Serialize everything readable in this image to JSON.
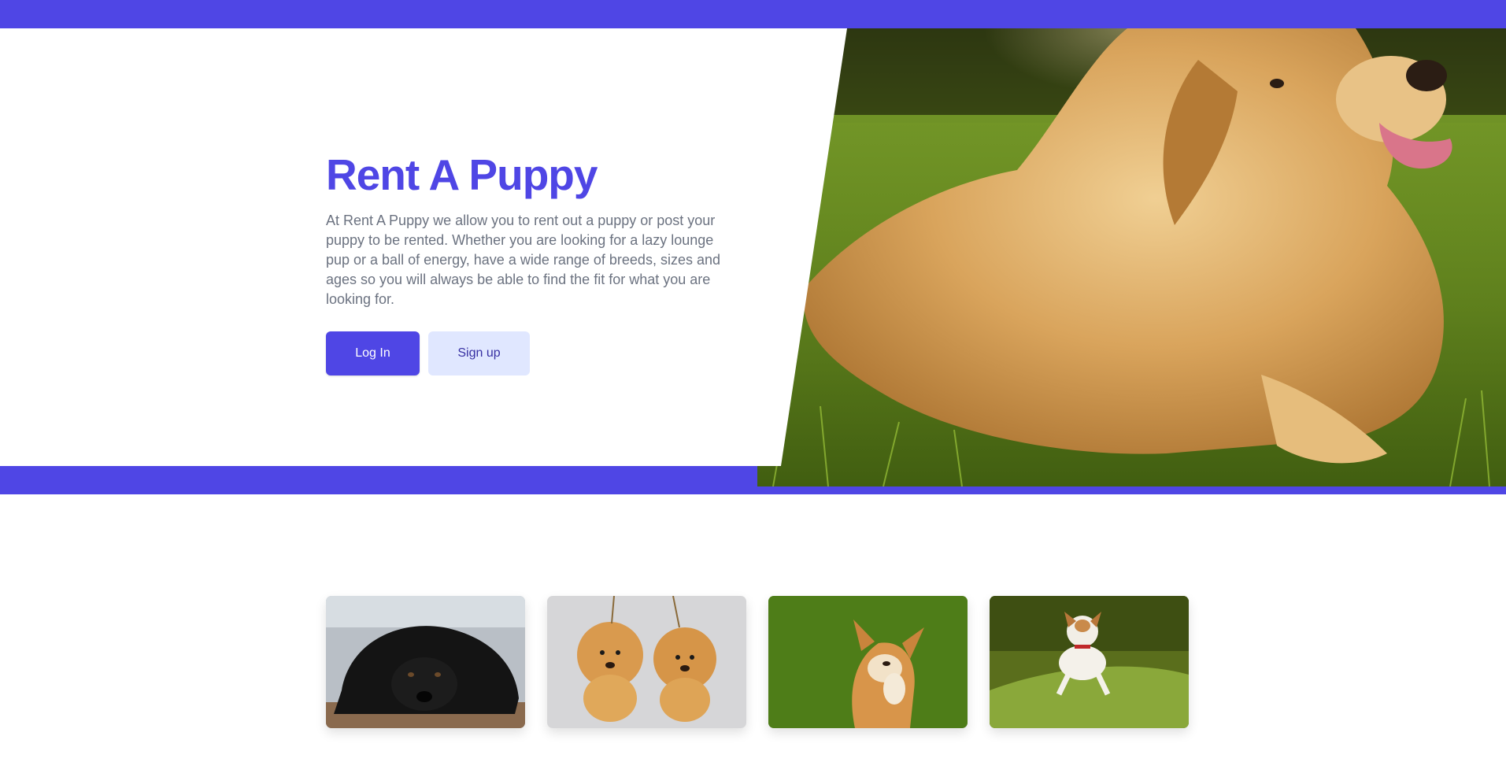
{
  "hero": {
    "title": "Rent A Puppy",
    "description": "At Rent A Puppy we allow you to rent out a puppy or post your puppy to be rented. Whether you are looking for a lazy lounge pup or a ball of energy, have a wide range of breeds, sizes and ages so you will always be able to find the fit for what you are looking for.",
    "login_label": "Log In",
    "signup_label": "Sign up",
    "image_icon": "golden-retriever-photo"
  },
  "gallery": {
    "cards": [
      {
        "icon": "black-dog-photo"
      },
      {
        "icon": "pomeranians-photo"
      },
      {
        "icon": "corgi-photo"
      },
      {
        "icon": "jack-russell-photo"
      }
    ]
  },
  "colors": {
    "accent": "#4f46e5",
    "accent_light": "#e0e7ff",
    "text_muted": "#6b7280"
  }
}
